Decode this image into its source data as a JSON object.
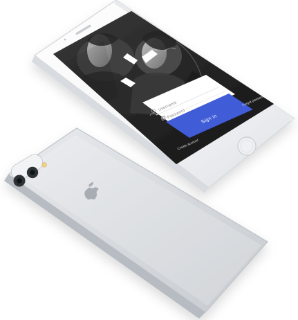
{
  "screen": {
    "email_placeholder": "Username",
    "password_placeholder": "Password",
    "sign_in_label": "Sign in",
    "create_account_label": "Create account",
    "forgot_password_label": "Forgot password?"
  },
  "colors": {
    "background": "#ffffff",
    "device_white": "#f5f5f7",
    "device_silver": "#d8dbdf",
    "screen_dark": "#2a2a2a",
    "form_white": "#ffffff",
    "accent_blue": "#3f5cd7",
    "text_gray": "#8d8d8d"
  },
  "icons": {
    "brand_mark": "chevron-check-icon",
    "user_field": "user-icon",
    "password_field": "lock-icon",
    "apple_logo": "apple-logo-icon",
    "camera": "camera-icon",
    "flash": "flash-icon",
    "home_button": "home-button-icon"
  }
}
